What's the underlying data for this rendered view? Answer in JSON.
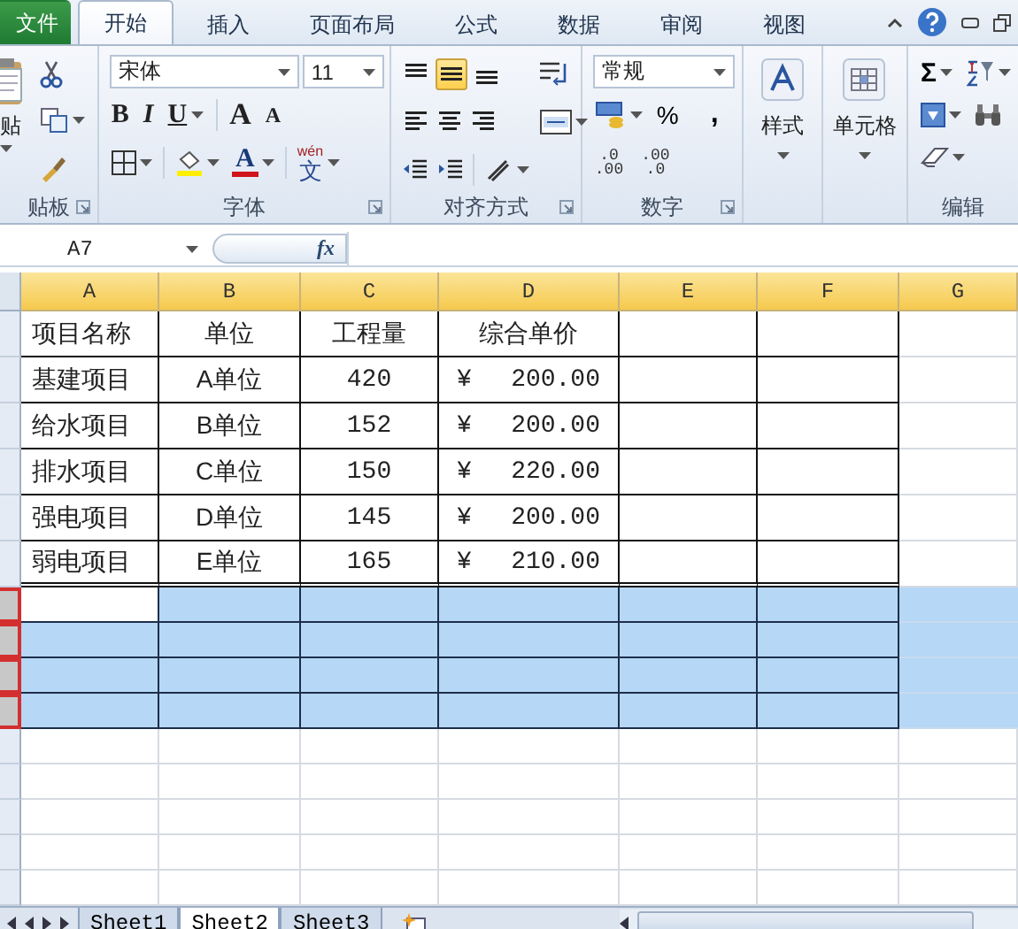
{
  "ribbon_tabs": [
    {
      "label": "文件",
      "kind": "file",
      "selected": false
    },
    {
      "label": "开始",
      "kind": "tab",
      "selected": true
    },
    {
      "label": "插入",
      "kind": "tab",
      "selected": false
    },
    {
      "label": "页面布局",
      "kind": "tab",
      "selected": false
    },
    {
      "label": "公式",
      "kind": "tab",
      "selected": false
    },
    {
      "label": "数据",
      "kind": "tab",
      "selected": false
    },
    {
      "label": "审阅",
      "kind": "tab",
      "selected": false
    },
    {
      "label": "视图",
      "kind": "tab",
      "selected": false
    }
  ],
  "clipboard": {
    "paste_label": "贴",
    "group_label": "贴板"
  },
  "font": {
    "name": "宋体",
    "size": "11",
    "bold": "B",
    "italic": "I",
    "underline": "U",
    "grow": "A",
    "shrink": "A",
    "font_color": "A",
    "phonetic_ruby": "wén",
    "phonetic_base": "文",
    "group_label": "字体"
  },
  "alignment": {
    "vertical": [
      {
        "kind": "top",
        "selected": false
      },
      {
        "kind": "middle",
        "selected": true
      },
      {
        "kind": "bottom",
        "selected": false
      }
    ],
    "horizontal": [
      {
        "kind": "left",
        "selected": false
      },
      {
        "kind": "center",
        "selected": false
      },
      {
        "kind": "right",
        "selected": false
      }
    ],
    "group_label": "对齐方式"
  },
  "number": {
    "format": "常规",
    "percent": "%",
    "comma": ",",
    "increase_decimal": [
      ".0",
      ".00"
    ],
    "decrease_decimal": [
      ".00",
      ".0"
    ],
    "group_label": "数字"
  },
  "styles": {
    "label": "样式"
  },
  "cells": {
    "label": "单元格"
  },
  "editing": {
    "sum": "Σ",
    "group_label": "编辑"
  },
  "formula_bar": {
    "name_box": "A7",
    "fx": "fx"
  },
  "columns": [
    {
      "label": "A"
    },
    {
      "label": "B"
    },
    {
      "label": "C"
    },
    {
      "label": "D"
    },
    {
      "label": "E"
    },
    {
      "label": "F"
    },
    {
      "label": "G"
    }
  ],
  "rows": [
    {
      "selected": false,
      "active": false,
      "cells": [
        {
          "kind": "text",
          "value": "项目名称"
        },
        {
          "kind": "text",
          "value": "单位"
        },
        {
          "kind": "text",
          "value": "工程量"
        },
        {
          "kind": "text",
          "value": "综合单价"
        }
      ]
    },
    {
      "selected": false,
      "active": false,
      "cells": [
        {
          "kind": "text",
          "value": "基建项目"
        },
        {
          "kind": "text",
          "value": "A单位"
        },
        {
          "kind": "text",
          "value": "420"
        },
        {
          "kind": "currency",
          "symbol": "¥",
          "amount": "200.00"
        }
      ]
    },
    {
      "selected": false,
      "active": false,
      "cells": [
        {
          "kind": "text",
          "value": "给水项目"
        },
        {
          "kind": "text",
          "value": "B单位"
        },
        {
          "kind": "text",
          "value": "152"
        },
        {
          "kind": "currency",
          "symbol": "¥",
          "amount": "200.00"
        }
      ]
    },
    {
      "selected": false,
      "active": false,
      "cells": [
        {
          "kind": "text",
          "value": "排水项目"
        },
        {
          "kind": "text",
          "value": "C单位"
        },
        {
          "kind": "text",
          "value": "150"
        },
        {
          "kind": "currency",
          "symbol": "¥",
          "amount": "220.00"
        }
      ]
    },
    {
      "selected": false,
      "active": false,
      "cells": [
        {
          "kind": "text",
          "value": "强电项目"
        },
        {
          "kind": "text",
          "value": "D单位"
        },
        {
          "kind": "text",
          "value": "145"
        },
        {
          "kind": "currency",
          "symbol": "¥",
          "amount": "200.00"
        }
      ]
    },
    {
      "selected": false,
      "active": false,
      "cells": [
        {
          "kind": "text",
          "value": "弱电项目"
        },
        {
          "kind": "text",
          "value": "E单位"
        },
        {
          "kind": "text",
          "value": "165"
        },
        {
          "kind": "currency",
          "symbol": "¥",
          "amount": "210.00"
        }
      ]
    },
    {
      "selected": true,
      "active": true
    },
    {
      "selected": true,
      "active": false
    },
    {
      "selected": true,
      "active": false
    },
    {
      "selected": true,
      "active": false
    },
    {
      "selected": false,
      "active": false
    },
    {
      "selected": false,
      "active": false
    },
    {
      "selected": false,
      "active": false
    },
    {
      "selected": false,
      "active": false
    },
    {
      "selected": false,
      "active": false
    }
  ],
  "sheet_tabs": [
    {
      "label": "Sheet1",
      "selected": false
    },
    {
      "label": "Sheet2",
      "selected": true
    },
    {
      "label": "Sheet3",
      "selected": false
    }
  ]
}
